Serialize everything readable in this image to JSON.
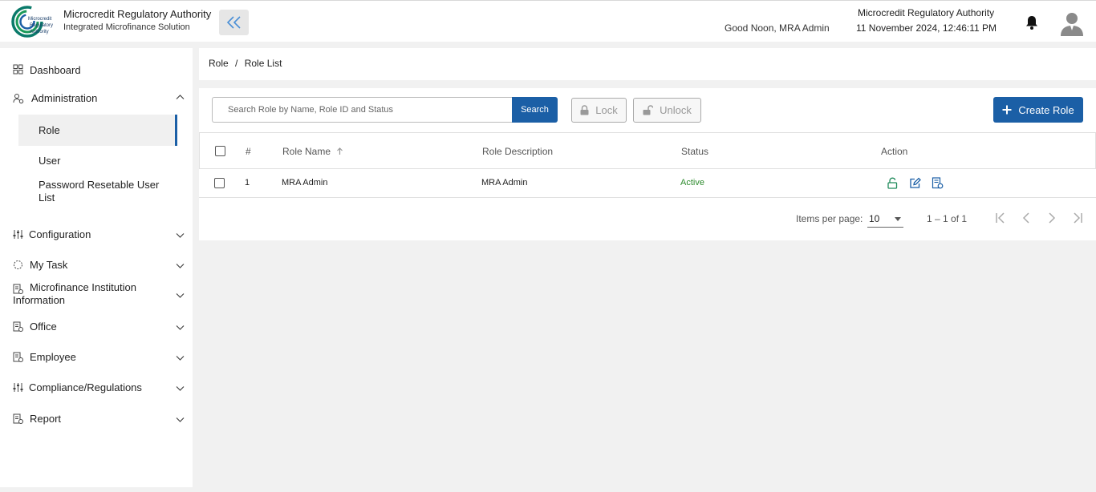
{
  "header": {
    "brand_title": "Microcredit Regulatory Authority",
    "brand_subtitle": "Integrated Microfinance Solution",
    "logo_text_1": "Microcredit",
    "logo_text_2": "Regulatory",
    "logo_text_3": "Authority",
    "greeting": "Good Noon, MRA Admin",
    "org_name": "Microcredit Regulatory Authority",
    "datetime": "11 November 2024, 12:46:11 PM"
  },
  "sidebar": {
    "dashboard": "Dashboard",
    "administration": "Administration",
    "sub_items": [
      "Role",
      "User",
      "Password Resetable User List"
    ],
    "configuration": "Configuration",
    "my_task": "My Task",
    "mfi_info": "Microfinance Institution Information",
    "office": "Office",
    "employee": "Employee",
    "compliance": "Compliance/Regulations",
    "report": "Report"
  },
  "breadcrumb": {
    "parent": "Role",
    "separator": "/",
    "current": "Role List"
  },
  "toolbar": {
    "search_placeholder": "Search Role by Name, Role ID and Status",
    "search_label": "Search",
    "lock_label": "Lock",
    "unlock_label": "Unlock",
    "create_label": "Create Role"
  },
  "table": {
    "headers": {
      "index": "#",
      "role_name": "Role Name",
      "role_description": "Role Description",
      "status": "Status",
      "action": "Action"
    },
    "rows": [
      {
        "index": "1",
        "role_name": "MRA Admin",
        "role_description": "MRA Admin",
        "status": "Active"
      }
    ]
  },
  "paginator": {
    "items_per_page_label": "Items per page:",
    "items_per_page": "10",
    "range": "1 – 1 of 1"
  },
  "colors": {
    "primary": "#1b5fa6",
    "active_status": "#2e8b2e",
    "icon_green": "#1f8a5a"
  }
}
